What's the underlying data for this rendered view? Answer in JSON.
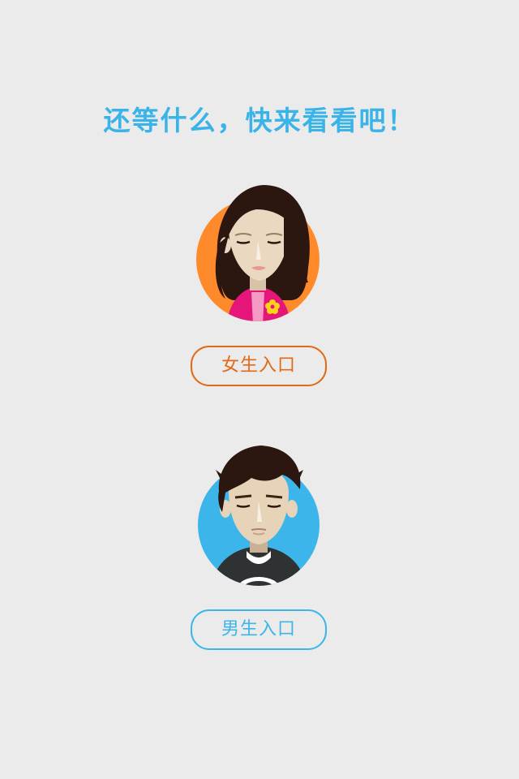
{
  "headline": "还等什么，快来看看吧！",
  "female": {
    "button_label": "女生入口",
    "circle_color": "#ff8a2b",
    "button_color": "#e06a16"
  },
  "male": {
    "button_label": "男生入口",
    "circle_color": "#3cb6ea",
    "button_color": "#3cb6ea"
  },
  "colors": {
    "background": "#ebebeb",
    "headline": "#3ab4e8"
  }
}
